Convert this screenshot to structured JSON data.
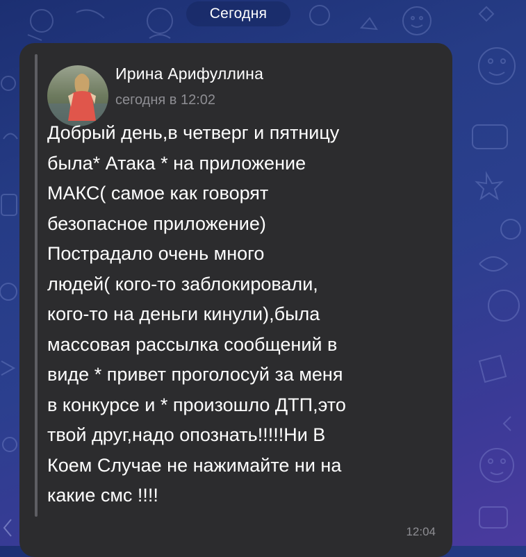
{
  "chat": {
    "date_separator": "Сегодня"
  },
  "message": {
    "author": "Ирина Арифуллина",
    "posted_at": "сегодня в 12:02",
    "text": "Добрый день,в четверг и пятницу\nбыла* Атака * на приложение\nМАКС( самое как говорят\nбезопасное приложение)\nПострадало очень много\nлюдей( кого-то заблокировали,\nкого-то на деньги кинули),была\nмассовая рассылка сообщений в\nвиде * привет проголосуй за меня\nв конкурсе и * произошло ДТП,это\nтвой друг,надо опознать!!!!!Ни В\nКоем Случае не нажимайте ни на\nкакие смс !!!!",
    "sent_time": "12:04",
    "avatar_icon": "user-photo-avatar"
  },
  "colors": {
    "background_top": "#1c2f72",
    "background_bottom": "#4a3a9e",
    "bubble": "#2c2c2e",
    "secondary_text": "#8e8e93"
  }
}
